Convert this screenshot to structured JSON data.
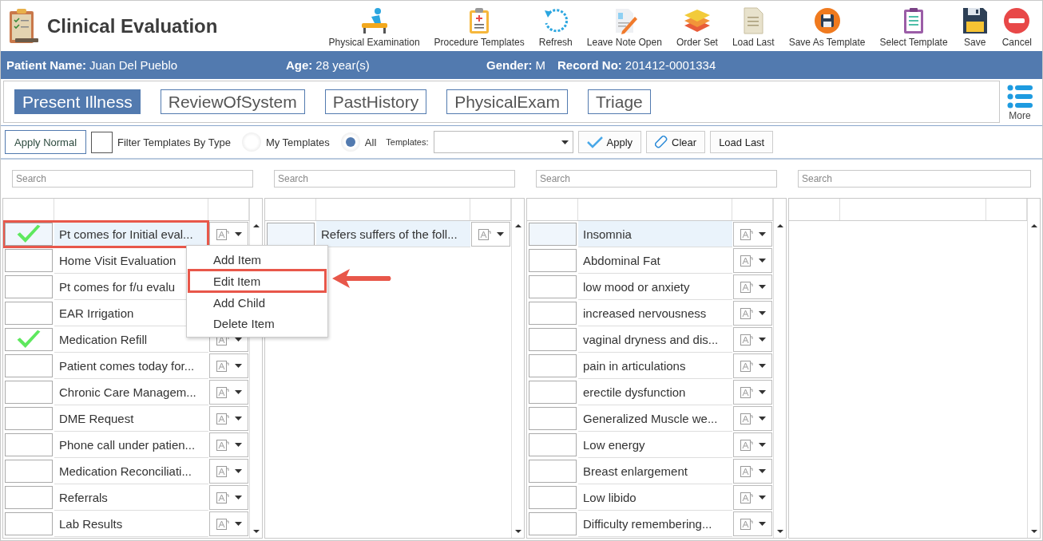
{
  "header": {
    "title": "Clinical Evaluation"
  },
  "toolbar": [
    {
      "label": "Physical Examination"
    },
    {
      "label": "Procedure Templates"
    },
    {
      "label": "Refresh"
    },
    {
      "label": "Leave Note Open"
    },
    {
      "label": "Order Set"
    },
    {
      "label": "Load Last"
    },
    {
      "label": "Save As Template"
    },
    {
      "label": "Select Template"
    },
    {
      "label": "Save"
    },
    {
      "label": "Cancel"
    }
  ],
  "patient": [
    {
      "label": "Patient Name:",
      "value": "Juan Del Pueblo"
    },
    {
      "label": "Age:",
      "value": "28 year(s)"
    },
    {
      "label": "Gender:",
      "value": "M"
    },
    {
      "label": "Record No:",
      "value": "201412-0001334"
    }
  ],
  "tabs": [
    {
      "label": "Present Illness",
      "selected": true
    },
    {
      "label": "ReviewOfSystem",
      "selected": false
    },
    {
      "label": "PastHistory",
      "selected": false
    },
    {
      "label": "PhysicalExam",
      "selected": false
    },
    {
      "label": "Triage",
      "selected": false
    }
  ],
  "more": {
    "label": "More"
  },
  "filter": {
    "apply_normal": "Apply Normal",
    "filter_by_type": {
      "label": "Filter Templates By Type",
      "checked": false
    },
    "scope": [
      {
        "label": "My Templates",
        "selected": false
      },
      {
        "label": "All",
        "selected": true
      }
    ],
    "templates_label": "Templates:",
    "apply": "Apply",
    "clear": "Clear",
    "load_last": "Load Last"
  },
  "lists": [
    {
      "placeholder": "Search",
      "rows": [
        {
          "text": "Pt comes for Initial eval...",
          "checked": true,
          "selected": true,
          "annotated": true
        },
        {
          "text": "Home Visit Evaluation",
          "checked": false,
          "selected": false,
          "annotated": false
        },
        {
          "text": "Pt comes for f/u evalu",
          "checked": false,
          "selected": false,
          "annotated": false
        },
        {
          "text": "EAR Irrigation",
          "checked": false,
          "selected": false,
          "annotated": false
        },
        {
          "text": "Medication Refill",
          "checked": true,
          "selected": false,
          "annotated": false
        },
        {
          "text": "Patient comes today for...",
          "checked": false,
          "selected": false,
          "annotated": false
        },
        {
          "text": "Chronic Care Managem...",
          "checked": false,
          "selected": false,
          "annotated": false
        },
        {
          "text": "DME Request",
          "checked": false,
          "selected": false,
          "annotated": false
        },
        {
          "text": "Phone call under patien...",
          "checked": false,
          "selected": false,
          "annotated": false
        },
        {
          "text": "Medication Reconciliati...",
          "checked": false,
          "selected": false,
          "annotated": false
        },
        {
          "text": "Referrals",
          "checked": false,
          "selected": false,
          "annotated": false
        },
        {
          "text": "Lab Results",
          "checked": false,
          "selected": false,
          "annotated": false
        }
      ]
    },
    {
      "placeholder": "Search",
      "rows": [
        {
          "text": "Refers suffers of the foll...",
          "checked": false,
          "selected": true,
          "annotated": false
        }
      ]
    },
    {
      "placeholder": "Search",
      "rows": [
        {
          "text": "Insomnia",
          "checked": false,
          "selected": true,
          "annotated": false
        },
        {
          "text": "Abdominal Fat",
          "checked": false,
          "selected": false,
          "annotated": false
        },
        {
          "text": "low mood or anxiety",
          "checked": false,
          "selected": false,
          "annotated": false
        },
        {
          "text": "increased nervousness",
          "checked": false,
          "selected": false,
          "annotated": false
        },
        {
          "text": "vaginal dryness and dis...",
          "checked": false,
          "selected": false,
          "annotated": false
        },
        {
          "text": "pain in articulations",
          "checked": false,
          "selected": false,
          "annotated": false
        },
        {
          "text": "erectile dysfunction",
          "checked": false,
          "selected": false,
          "annotated": false
        },
        {
          "text": "Generalized Muscle we...",
          "checked": false,
          "selected": false,
          "annotated": false
        },
        {
          "text": "Low energy",
          "checked": false,
          "selected": false,
          "annotated": false
        },
        {
          "text": "Breast enlargement",
          "checked": false,
          "selected": false,
          "annotated": false
        },
        {
          "text": "Low libido",
          "checked": false,
          "selected": false,
          "annotated": false
        },
        {
          "text": "Difficulty remembering...",
          "checked": false,
          "selected": false,
          "annotated": false
        }
      ]
    },
    {
      "placeholder": "Search"
    }
  ],
  "context_menu": [
    {
      "label": "Add Item",
      "annotated": false
    },
    {
      "label": "Edit Item",
      "annotated": true
    },
    {
      "label": "Add Child",
      "annotated": false
    },
    {
      "label": "Delete Item",
      "annotated": false
    }
  ]
}
